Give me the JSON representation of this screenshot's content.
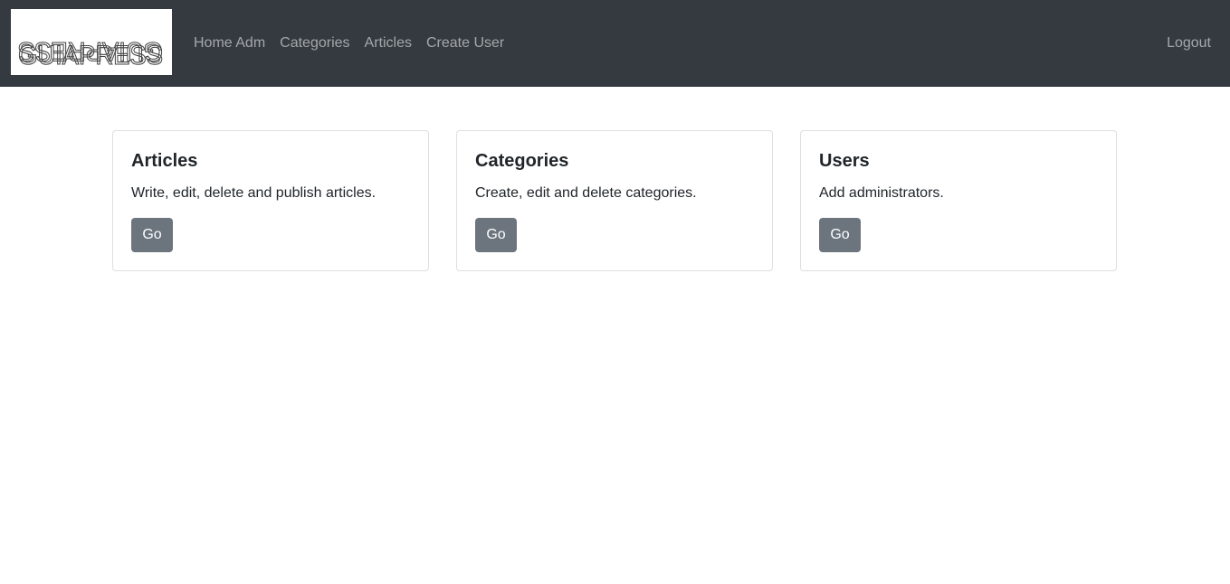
{
  "navbar": {
    "brand_text": "GUIAPRESS",
    "links": [
      {
        "label": "Home Adm"
      },
      {
        "label": "Categories"
      },
      {
        "label": "Articles"
      },
      {
        "label": "Create User"
      }
    ],
    "logout_label": "Logout"
  },
  "cards": [
    {
      "title": "Articles",
      "text": "Write, edit, delete and publish articles.",
      "button_label": "Go"
    },
    {
      "title": "Categories",
      "text": "Create, edit and delete categories.",
      "button_label": "Go"
    },
    {
      "title": "Users",
      "text": "Add administrators.",
      "button_label": "Go"
    }
  ],
  "colors": {
    "navbar_bg": "#343a40",
    "nav_link": "rgba(255,255,255,0.55)",
    "button_bg": "#6c757d"
  }
}
